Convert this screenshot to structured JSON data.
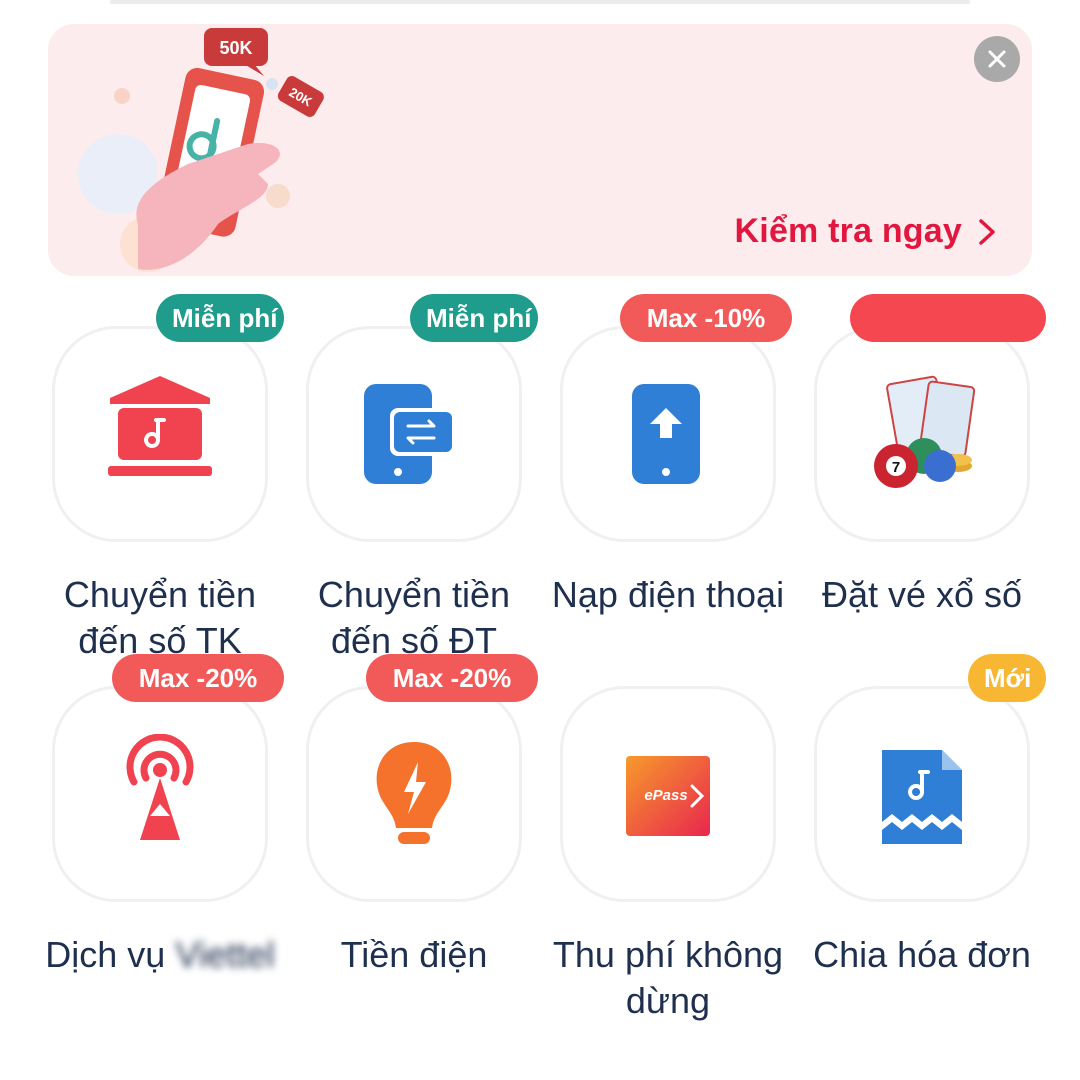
{
  "banner": {
    "cta_label": "Kiểm tra ngay",
    "bubble_big": "50K",
    "bubble_small": "20K"
  },
  "services": [
    {
      "label": "Chuyển tiền đến số TK",
      "badge": "Miễn phí",
      "badge_color": "#1f9c8c",
      "icon": "bank-icon"
    },
    {
      "label": "Chuyển tiền đến số ĐT",
      "badge": "Miễn phí",
      "badge_color": "#1f9c8c",
      "icon": "phone-transfer-icon"
    },
    {
      "label": "Nạp điện thoại",
      "badge": "Max -10%",
      "badge_color": "#f25a5a",
      "icon": "phone-topup-icon"
    },
    {
      "label": "Đặt vé xổ số",
      "badge": "",
      "badge_color": "#f5474f",
      "icon": "lottery-icon"
    },
    {
      "label_prefix": "Dịch vụ",
      "label_blurred": "Viettel",
      "badge": "Max -20%",
      "badge_color": "#f25a5a",
      "icon": "antenna-icon"
    },
    {
      "label": "Tiền điện",
      "badge": "Max -20%",
      "badge_color": "#f25a5a",
      "icon": "lightbulb-icon"
    },
    {
      "label": "Thu phí không dừng",
      "badge": "",
      "icon": "epass-icon",
      "icon_text": "ePass"
    },
    {
      "label": "Chia hóa đơn",
      "badge": "Mới",
      "badge_color": "#f7b733",
      "icon": "split-bill-icon"
    }
  ],
  "colors": {
    "accent_red": "#e11740",
    "text_navy": "#1f2f4e",
    "icon_blue": "#2f7fd6",
    "icon_red": "#f0424f"
  }
}
